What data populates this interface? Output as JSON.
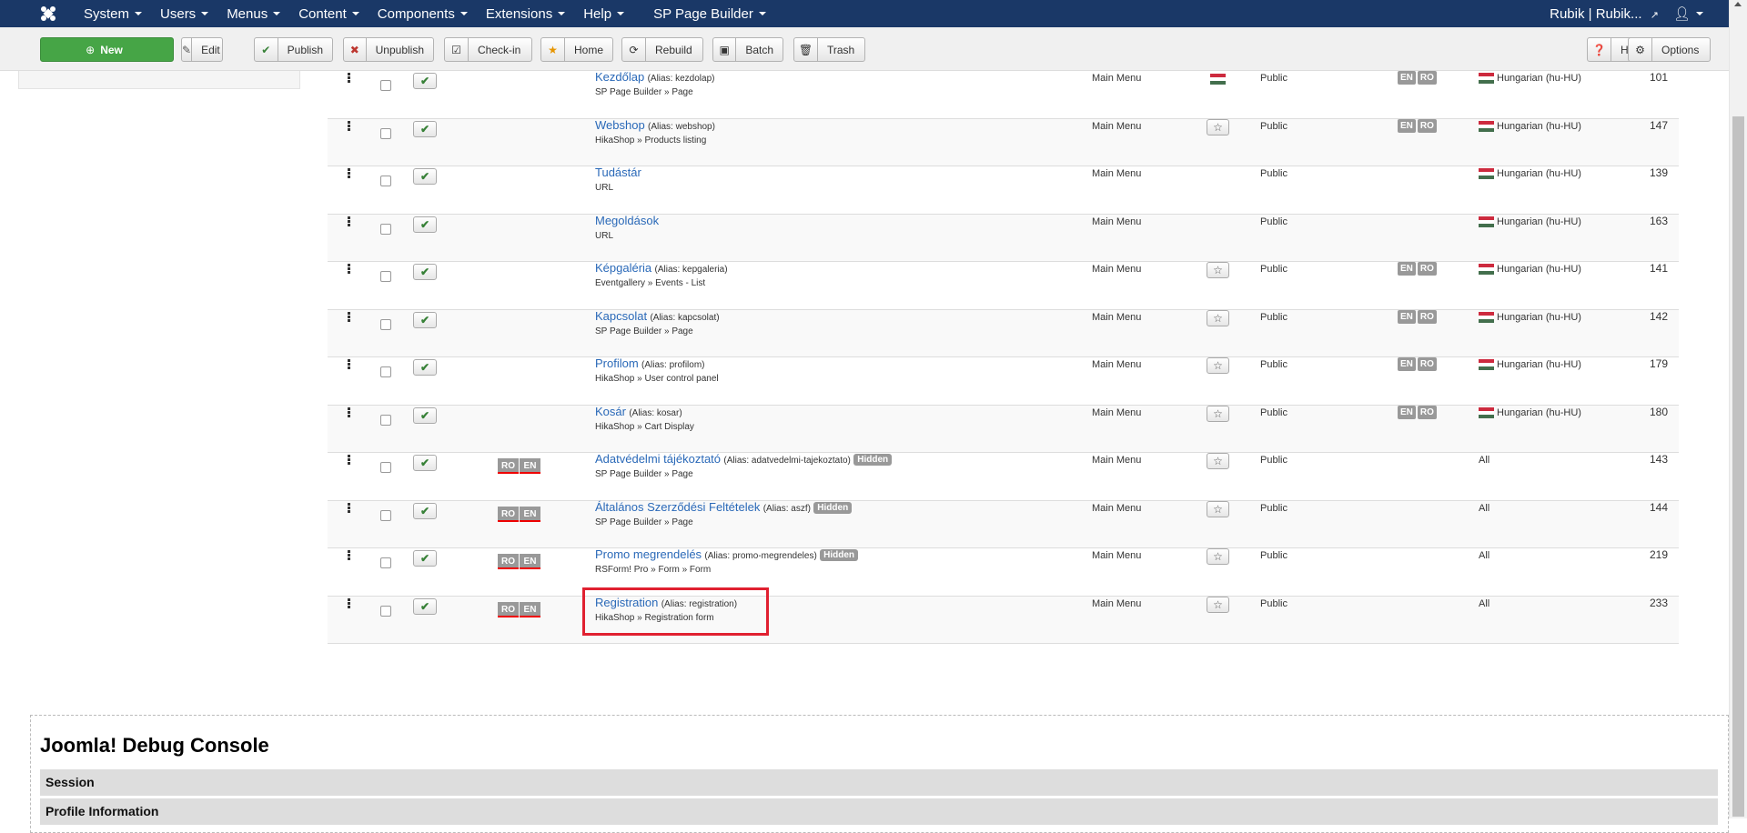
{
  "navbar": {
    "menu": [
      "System",
      "Users",
      "Menus",
      "Content",
      "Components",
      "Extensions",
      "Help",
      "SP Page Builder"
    ],
    "user": "Rubik | Rubik...",
    "user_menu": "☃"
  },
  "toolbar": {
    "buttons": [
      {
        "label": "New",
        "icon": "plus-circle-icon"
      },
      {
        "label": "Edit",
        "icon": "edit-icon"
      },
      {
        "label": "Publish",
        "icon": "check-icon"
      },
      {
        "label": "Unpublish",
        "icon": "unpublish-icon"
      },
      {
        "label": "Check-in",
        "icon": "checkin-icon"
      },
      {
        "label": "Home",
        "icon": "star-icon"
      },
      {
        "label": "Rebuild",
        "icon": "refresh-icon"
      },
      {
        "label": "Batch",
        "icon": "batch-icon"
      },
      {
        "label": "Trash",
        "icon": "trash-icon"
      }
    ],
    "help_label": "Help",
    "options_label": "Options"
  },
  "rows": [
    {
      "title": "Kezdőlap",
      "alias": "(Alias: kezdolap)",
      "badge": "",
      "sub": "SP Page Builder » Page",
      "menu": "Main Menu",
      "home": "flag",
      "access": "Public",
      "langs": [
        "EN",
        "RO"
      ],
      "language": "Hungarian (hu-HU)",
      "id": "101",
      "assoc": []
    },
    {
      "title": "Webshop",
      "alias": "(Alias: webshop)",
      "badge": "",
      "sub": "HikaShop » Products listing",
      "menu": "Main Menu",
      "home": "star",
      "access": "Public",
      "langs": [
        "EN",
        "RO"
      ],
      "language": "Hungarian (hu-HU)",
      "id": "147",
      "assoc": []
    },
    {
      "title": "Tudástár",
      "alias": "",
      "badge": "",
      "sub": "URL",
      "menu": "Main Menu",
      "home": "",
      "access": "Public",
      "langs": [],
      "language": "Hungarian (hu-HU)",
      "id": "139",
      "assoc": []
    },
    {
      "title": "Megoldások",
      "alias": "",
      "badge": "",
      "sub": "URL",
      "menu": "Main Menu",
      "home": "",
      "access": "Public",
      "langs": [],
      "language": "Hungarian (hu-HU)",
      "id": "163",
      "assoc": []
    },
    {
      "title": "Képgaléria",
      "alias": "(Alias: kepgaleria)",
      "badge": "",
      "sub": "Eventgallery » Events - List",
      "menu": "Main Menu",
      "home": "star",
      "access": "Public",
      "langs": [
        "EN",
        "RO"
      ],
      "language": "Hungarian (hu-HU)",
      "id": "141",
      "assoc": []
    },
    {
      "title": "Kapcsolat",
      "alias": "(Alias: kapcsolat)",
      "badge": "",
      "sub": "SP Page Builder » Page",
      "menu": "Main Menu",
      "home": "star",
      "access": "Public",
      "langs": [
        "EN",
        "RO"
      ],
      "language": "Hungarian (hu-HU)",
      "id": "142",
      "assoc": []
    },
    {
      "title": "Profilom",
      "alias": "(Alias: profilom)",
      "badge": "",
      "sub": "HikaShop » User control panel",
      "menu": "Main Menu",
      "home": "star",
      "access": "Public",
      "langs": [
        "EN",
        "RO"
      ],
      "language": "Hungarian (hu-HU)",
      "id": "179",
      "assoc": []
    },
    {
      "title": "Kosár",
      "alias": "(Alias: kosar)",
      "badge": "",
      "sub": "HikaShop » Cart Display",
      "menu": "Main Menu",
      "home": "star",
      "access": "Public",
      "langs": [
        "EN",
        "RO"
      ],
      "language": "Hungarian (hu-HU)",
      "id": "180",
      "assoc": []
    },
    {
      "title": "Adatvédelmi tájékoztató",
      "alias": "(Alias: adatvedelmi-tajekoztato)",
      "badge": "Hidden",
      "sub": "SP Page Builder » Page",
      "menu": "Main Menu",
      "home": "star",
      "access": "Public",
      "langs": [],
      "language": "All",
      "id": "143",
      "assoc": [
        "RO",
        "EN"
      ]
    },
    {
      "title": "Általános Szerződési Feltételek",
      "alias": "(Alias: aszf)",
      "badge": "Hidden",
      "sub": "SP Page Builder » Page",
      "menu": "Main Menu",
      "home": "star",
      "access": "Public",
      "langs": [],
      "language": "All",
      "id": "144",
      "assoc": [
        "RO",
        "EN"
      ]
    },
    {
      "title": "Promo megrendelés",
      "alias": "(Alias: promo-megrendeles)",
      "badge": "Hidden",
      "sub": "RSForm! Pro » Form » Form",
      "menu": "Main Menu",
      "home": "star",
      "access": "Public",
      "langs": [],
      "language": "All",
      "id": "219",
      "assoc": [
        "RO",
        "EN"
      ]
    },
    {
      "title": "Registration",
      "alias": "(Alias: registration)",
      "badge": "",
      "sub": "HikaShop » Registration form",
      "menu": "Main Menu",
      "home": "star",
      "access": "Public",
      "langs": [],
      "language": "All",
      "id": "233",
      "assoc": [
        "RO",
        "EN"
      ]
    }
  ],
  "debug": {
    "title": "Joomla! Debug Console",
    "sections": [
      "Session",
      "Profile Information"
    ]
  },
  "colors": {
    "navbar": "#1a3867",
    "link": "#2a69b8",
    "new_button": "#46a546",
    "highlight": "#e02030"
  }
}
